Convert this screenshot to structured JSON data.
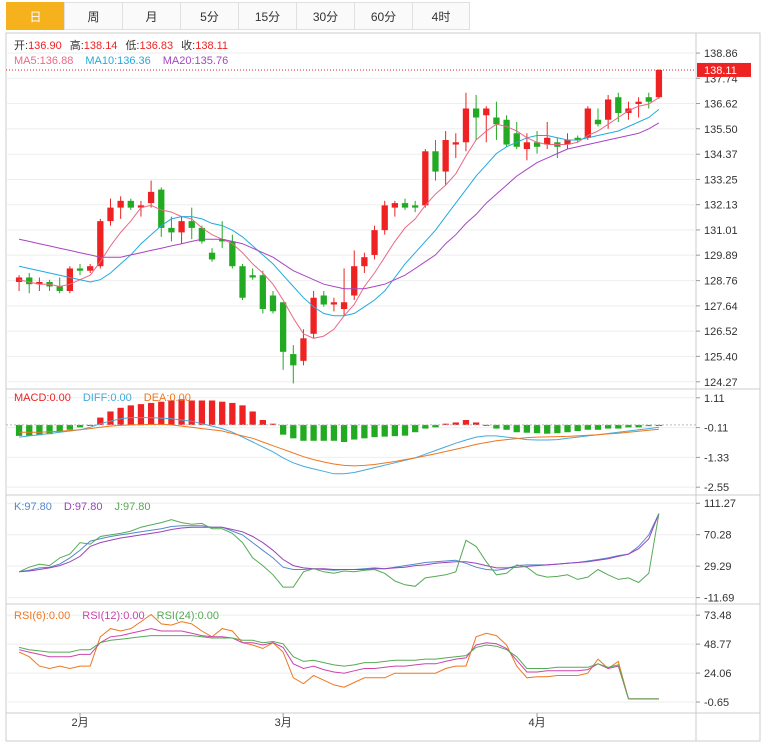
{
  "tabs": [
    {
      "label": "日",
      "active": true
    },
    {
      "label": "周",
      "active": false
    },
    {
      "label": "月",
      "active": false
    },
    {
      "label": "5分",
      "active": false
    },
    {
      "label": "15分",
      "active": false
    },
    {
      "label": "30分",
      "active": false
    },
    {
      "label": "60分",
      "active": false
    },
    {
      "label": "4时",
      "active": false
    }
  ],
  "colors": {
    "up": "#ee2222",
    "down": "#22aa22",
    "ma5": "#e86a86",
    "ma10": "#22aadd",
    "ma20": "#a844c4",
    "diff": "#44aadd",
    "dea": "#ee7722",
    "k": "#5588cc",
    "d": "#9944bb",
    "j": "#55aa55",
    "rsi6": "#ee7722",
    "rsi12": "#cc44aa",
    "rsi24": "#55aa55"
  },
  "chart_data": [
    {
      "type": "candlestick",
      "legend_ohlc": [
        {
          "label": "开:",
          "value": "136.90"
        },
        {
          "label": "高:",
          "value": "138.14"
        },
        {
          "label": "低:",
          "value": "136.83"
        },
        {
          "label": "收:",
          "value": "138.11"
        }
      ],
      "legend_ma": [
        {
          "label": "MA5:",
          "value": "136.88",
          "color_key": "ma5"
        },
        {
          "label": "MA10:",
          "value": "136.36",
          "color_key": "ma10"
        },
        {
          "label": "MA20:",
          "value": "135.76",
          "color_key": "ma20"
        }
      ],
      "y_ticks": [
        "138.86",
        "137.74",
        "136.62",
        "135.50",
        "134.37",
        "133.25",
        "132.13",
        "131.01",
        "129.89",
        "128.76",
        "127.64",
        "126.52",
        "125.40",
        "124.27"
      ],
      "ylim": [
        123.95,
        139.75
      ],
      "last_price": "138.11",
      "ohlc": [
        [
          128.7,
          129.0,
          128.3,
          128.9
        ],
        [
          128.9,
          129.1,
          128.2,
          128.6
        ],
        [
          128.6,
          128.9,
          128.3,
          128.7
        ],
        [
          128.7,
          128.8,
          128.3,
          128.5
        ],
        [
          128.5,
          128.9,
          128.2,
          128.3
        ],
        [
          128.3,
          129.4,
          128.2,
          129.3
        ],
        [
          129.3,
          129.5,
          129.0,
          129.2
        ],
        [
          129.2,
          129.5,
          129.1,
          129.4
        ],
        [
          129.4,
          131.5,
          129.3,
          131.4
        ],
        [
          131.4,
          132.4,
          131.2,
          132.0
        ],
        [
          132.0,
          132.5,
          131.5,
          132.3
        ],
        [
          132.3,
          132.4,
          131.9,
          132.0
        ],
        [
          132.0,
          132.3,
          131.6,
          132.1
        ],
        [
          132.2,
          133.2,
          132.0,
          132.7
        ],
        [
          132.8,
          132.9,
          130.7,
          131.1
        ],
        [
          131.1,
          131.6,
          130.5,
          130.9
        ],
        [
          130.9,
          131.6,
          130.4,
          131.4
        ],
        [
          131.4,
          132.0,
          130.6,
          131.1
        ],
        [
          131.1,
          131.2,
          130.4,
          130.5
        ],
        [
          130.0,
          130.2,
          129.6,
          129.7
        ],
        [
          130.6,
          131.4,
          130.2,
          130.5
        ],
        [
          130.5,
          130.8,
          129.3,
          129.4
        ],
        [
          129.4,
          129.5,
          127.9,
          128.0
        ],
        [
          129.0,
          129.3,
          128.8,
          128.9
        ],
        [
          129.0,
          129.2,
          127.3,
          127.5
        ],
        [
          128.1,
          128.3,
          127.3,
          127.4
        ],
        [
          127.8,
          127.8,
          124.8,
          125.6
        ],
        [
          125.5,
          125.9,
          124.2,
          125.0
        ],
        [
          125.2,
          126.6,
          125.0,
          126.2
        ],
        [
          126.4,
          128.3,
          126.2,
          128.0
        ],
        [
          128.1,
          128.3,
          127.6,
          127.7
        ],
        [
          127.7,
          128.0,
          127.4,
          127.8
        ],
        [
          127.5,
          129.3,
          127.2,
          127.8
        ],
        [
          128.1,
          130.1,
          127.9,
          129.4
        ],
        [
          129.4,
          130.0,
          129.1,
          129.8
        ],
        [
          129.9,
          131.2,
          129.7,
          131.0
        ],
        [
          131.0,
          132.3,
          130.8,
          132.1
        ],
        [
          132.0,
          132.3,
          131.6,
          132.2
        ],
        [
          132.2,
          132.4,
          131.9,
          132.0
        ],
        [
          132.1,
          132.3,
          131.8,
          132.0
        ],
        [
          132.1,
          134.6,
          132.0,
          134.5
        ],
        [
          134.5,
          135.0,
          133.2,
          133.6
        ],
        [
          133.6,
          135.4,
          133.0,
          135.0
        ],
        [
          134.8,
          135.3,
          134.2,
          134.9
        ],
        [
          134.9,
          137.1,
          134.5,
          136.4
        ],
        [
          136.4,
          137.0,
          135.0,
          136.0
        ],
        [
          136.1,
          136.5,
          134.9,
          136.4
        ],
        [
          136.0,
          136.7,
          135.0,
          135.7
        ],
        [
          135.9,
          136.1,
          134.7,
          134.8
        ],
        [
          135.3,
          135.8,
          134.6,
          134.7
        ],
        [
          134.6,
          135.3,
          134.1,
          134.9
        ],
        [
          134.9,
          135.4,
          134.4,
          134.7
        ],
        [
          134.8,
          135.8,
          134.6,
          135.1
        ],
        [
          134.9,
          135.1,
          134.2,
          134.7
        ],
        [
          134.8,
          135.3,
          134.6,
          135.0
        ],
        [
          135.1,
          135.2,
          134.9,
          135.0
        ],
        [
          135.1,
          136.5,
          135.0,
          136.4
        ],
        [
          135.9,
          136.4,
          135.6,
          135.7
        ],
        [
          135.9,
          137.0,
          135.5,
          136.8
        ],
        [
          136.9,
          137.1,
          135.8,
          136.2
        ],
        [
          136.2,
          136.7,
          135.9,
          136.4
        ],
        [
          136.6,
          136.9,
          136.0,
          136.7
        ],
        [
          136.9,
          137.1,
          136.4,
          136.7
        ],
        [
          136.9,
          138.14,
          136.83,
          138.11
        ]
      ],
      "ma5": [
        128.8,
        128.7,
        128.6,
        128.6,
        128.5,
        128.6,
        128.8,
        129.0,
        129.6,
        130.3,
        130.9,
        131.4,
        132.0,
        132.1,
        131.9,
        131.8,
        131.6,
        131.5,
        131.1,
        130.8,
        130.6,
        130.4,
        130.0,
        129.5,
        129.1,
        128.6,
        127.9,
        127.1,
        126.4,
        126.2,
        126.3,
        126.6,
        127.2,
        127.7,
        128.5,
        129.1,
        129.8,
        130.5,
        131.1,
        131.5,
        132.1,
        132.6,
        133.0,
        133.5,
        134.3,
        135.0,
        135.4,
        135.7,
        135.6,
        135.4,
        135.1,
        134.9,
        134.8,
        134.8,
        134.8,
        134.9,
        135.2,
        135.4,
        135.7,
        136.0,
        136.3,
        136.5,
        136.6,
        136.88
      ],
      "ma10": [
        129.4,
        129.3,
        129.2,
        129.1,
        129.0,
        128.9,
        128.8,
        128.7,
        128.8,
        129.1,
        129.5,
        129.9,
        130.4,
        130.8,
        131.2,
        131.5,
        131.6,
        131.6,
        131.5,
        131.3,
        131.2,
        131.0,
        130.7,
        130.3,
        129.9,
        129.5,
        129.0,
        128.5,
        128.0,
        127.6,
        127.3,
        127.2,
        127.2,
        127.3,
        127.6,
        127.9,
        128.3,
        128.9,
        129.5,
        130.0,
        130.5,
        131.0,
        131.6,
        132.2,
        132.8,
        133.4,
        133.9,
        134.4,
        134.7,
        134.9,
        135.1,
        135.2,
        135.2,
        135.1,
        135.0,
        135.0,
        135.1,
        135.2,
        135.3,
        135.4,
        135.6,
        135.8,
        136.0,
        136.36
      ],
      "ma20": [
        130.6,
        130.5,
        130.4,
        130.3,
        130.2,
        130.1,
        130.0,
        129.9,
        129.8,
        129.8,
        129.8,
        129.9,
        130.0,
        130.1,
        130.2,
        130.3,
        130.4,
        130.5,
        130.6,
        130.6,
        130.6,
        130.5,
        130.4,
        130.2,
        130.0,
        129.8,
        129.5,
        129.2,
        129.0,
        128.8,
        128.6,
        128.5,
        128.4,
        128.4,
        128.4,
        128.5,
        128.6,
        128.8,
        129.0,
        129.3,
        129.6,
        129.9,
        130.4,
        130.8,
        131.3,
        131.7,
        132.2,
        132.6,
        133.0,
        133.4,
        133.7,
        134.0,
        134.2,
        134.4,
        134.6,
        134.7,
        134.8,
        134.9,
        135.0,
        135.1,
        135.2,
        135.3,
        135.5,
        135.76
      ]
    },
    {
      "type": "bar",
      "legend": [
        {
          "label": "MACD:",
          "value": "0.00",
          "color_key": "up"
        },
        {
          "label": "DIFF:",
          "value": "0.00",
          "color_key": "diff"
        },
        {
          "label": "DEA:",
          "value": "0.00",
          "color_key": "dea"
        }
      ],
      "y_ticks": [
        "1.11",
        "-0.11",
        "-1.33",
        "-2.55"
      ],
      "ylim": [
        -2.87,
        1.47
      ],
      "macd": [
        -0.45,
        -0.45,
        -0.42,
        -0.38,
        -0.3,
        -0.2,
        -0.1,
        0,
        0.3,
        0.55,
        0.7,
        0.8,
        0.85,
        0.9,
        0.95,
        1.0,
        1.05,
        1.0,
        1.0,
        1.0,
        0.95,
        0.9,
        0.8,
        0.55,
        0.2,
        0.05,
        -0.4,
        -0.55,
        -0.65,
        -0.65,
        -0.65,
        -0.65,
        -0.7,
        -0.6,
        -0.55,
        -0.5,
        -0.48,
        -0.46,
        -0.44,
        -0.3,
        -0.15,
        -0.1,
        0.05,
        0.1,
        0.2,
        0.1,
        0,
        -0.15,
        -0.2,
        -0.3,
        -0.32,
        -0.34,
        -0.36,
        -0.34,
        -0.3,
        -0.25,
        -0.2,
        -0.2,
        -0.15,
        -0.15,
        -0.1,
        -0.1,
        -0.05,
        0
      ],
      "diff": [
        -0.5,
        -0.45,
        -0.4,
        -0.35,
        -0.3,
        -0.25,
        -0.2,
        -0.1,
        0.05,
        0.15,
        0.25,
        0.3,
        0.3,
        0.3,
        0.28,
        0.25,
        0.2,
        0.15,
        0.05,
        -0.05,
        -0.15,
        -0.3,
        -0.5,
        -0.7,
        -0.9,
        -1.1,
        -1.35,
        -1.55,
        -1.7,
        -1.8,
        -1.9,
        -2.0,
        -2.0,
        -1.95,
        -1.85,
        -1.75,
        -1.65,
        -1.55,
        -1.45,
        -1.35,
        -1.2,
        -1.05,
        -0.9,
        -0.75,
        -0.62,
        -0.5,
        -0.45,
        -0.45,
        -0.5,
        -0.55,
        -0.6,
        -0.62,
        -0.62,
        -0.6,
        -0.55,
        -0.5,
        -0.45,
        -0.4,
        -0.35,
        -0.3,
        -0.25,
        -0.2,
        -0.15,
        -0.1
      ],
      "dea": [
        -0.3,
        -0.3,
        -0.3,
        -0.28,
        -0.26,
        -0.23,
        -0.2,
        -0.15,
        -0.1,
        -0.05,
        -0.02,
        0.0,
        0.01,
        0.02,
        0.02,
        0.0,
        -0.05,
        -0.1,
        -0.15,
        -0.2,
        -0.25,
        -0.35,
        -0.45,
        -0.55,
        -0.7,
        -0.85,
        -1.0,
        -1.15,
        -1.3,
        -1.42,
        -1.52,
        -1.6,
        -1.66,
        -1.68,
        -1.66,
        -1.62,
        -1.56,
        -1.5,
        -1.42,
        -1.35,
        -1.27,
        -1.18,
        -1.09,
        -1.0,
        -0.9,
        -0.8,
        -0.72,
        -0.65,
        -0.6,
        -0.56,
        -0.52,
        -0.5,
        -0.49,
        -0.48,
        -0.47,
        -0.45,
        -0.42,
        -0.4,
        -0.37,
        -0.34,
        -0.3,
        -0.26,
        -0.22,
        -0.18
      ]
    },
    {
      "type": "line",
      "legend": [
        {
          "label": "K:",
          "value": "97.80",
          "color_key": "k"
        },
        {
          "label": "D:",
          "value": "97.80",
          "color_key": "d"
        },
        {
          "label": "J:",
          "value": "97.80",
          "color_key": "j"
        }
      ],
      "y_ticks": [
        "111.27",
        "70.28",
        "29.29",
        "-11.69"
      ],
      "ylim": [
        -20.0,
        122.0
      ],
      "k": [
        22,
        24,
        27,
        28,
        32,
        40,
        50,
        62,
        65,
        68,
        70,
        72,
        74,
        76,
        78,
        81,
        82,
        82,
        82,
        80,
        80,
        75,
        70,
        60,
        50,
        40,
        28,
        25,
        25,
        26,
        25,
        24,
        25,
        25,
        26,
        27,
        26,
        28,
        30,
        32,
        34,
        35,
        36,
        37,
        33,
        28,
        25,
        24,
        26,
        30,
        31,
        31,
        31,
        32,
        33,
        34,
        36,
        38,
        40,
        43,
        45,
        55,
        70,
        97.8
      ],
      "d": [
        22,
        23,
        25,
        27,
        30,
        35,
        42,
        55,
        60,
        63,
        66,
        68,
        70,
        72,
        74,
        77,
        79,
        80,
        80,
        80,
        80,
        77,
        74,
        68,
        60,
        50,
        38,
        30,
        27,
        26,
        26,
        25,
        25,
        25,
        25,
        26,
        26,
        27,
        28,
        30,
        31,
        33,
        34,
        35,
        35,
        33,
        30,
        27,
        27,
        28,
        29,
        30,
        31,
        32,
        33,
        34,
        35,
        37,
        39,
        42,
        45,
        52,
        65,
        97.8
      ],
      "j": [
        22,
        28,
        32,
        30,
        40,
        45,
        60,
        58,
        68,
        70,
        72,
        75,
        80,
        83,
        86,
        90,
        86,
        84,
        85,
        78,
        78,
        72,
        60,
        40,
        30,
        18,
        2,
        2,
        22,
        26,
        22,
        20,
        23,
        22,
        24,
        25,
        20,
        10,
        5,
        3,
        14,
        16,
        18,
        22,
        63,
        55,
        35,
        18,
        20,
        31,
        28,
        18,
        15,
        16,
        18,
        12,
        15,
        25,
        18,
        12,
        14,
        8,
        20,
        97.8
      ]
    },
    {
      "type": "line",
      "legend": [
        {
          "label": "RSI(6):",
          "value": "0.00",
          "color_key": "rsi6"
        },
        {
          "label": "RSI(12):",
          "value": "0.00",
          "color_key": "rsi12"
        },
        {
          "label": "RSI(24):",
          "value": "0.00",
          "color_key": "rsi24"
        }
      ],
      "y_ticks": [
        "73.48",
        "48.77",
        "24.06",
        "-0.65"
      ],
      "ylim": [
        -10.0,
        83.0
      ],
      "x_labels": [
        {
          "label": "2月",
          "index": 6
        },
        {
          "label": "3月",
          "index": 26
        },
        {
          "label": "4月",
          "index": 51
        }
      ],
      "rsi6": [
        42,
        38,
        30,
        28,
        30,
        28,
        30,
        30,
        55,
        62,
        60,
        62,
        68,
        74,
        66,
        65,
        68,
        66,
        60,
        55,
        62,
        60,
        50,
        48,
        45,
        50,
        42,
        20,
        15,
        22,
        18,
        14,
        12,
        16,
        20,
        20,
        20,
        24,
        24,
        24,
        24,
        24,
        28,
        30,
        30,
        55,
        58,
        56,
        48,
        30,
        20,
        21,
        21,
        22,
        22,
        22,
        24,
        36,
        28,
        34,
        2,
        2,
        2,
        2
      ],
      "rsi12": [
        44,
        42,
        40,
        38,
        38,
        38,
        40,
        40,
        50,
        55,
        56,
        58,
        60,
        62,
        60,
        60,
        60,
        58,
        56,
        55,
        55,
        54,
        50,
        50,
        48,
        50,
        46,
        32,
        28,
        30,
        27,
        25,
        24,
        26,
        28,
        28,
        29,
        30,
        30,
        31,
        32,
        32,
        34,
        36,
        37,
        48,
        50,
        49,
        45,
        35,
        25,
        25,
        26,
        26,
        26,
        26,
        27,
        32,
        28,
        30,
        2,
        2,
        2,
        2
      ],
      "rsi24": [
        46,
        44,
        43,
        42,
        42,
        42,
        44,
        44,
        50,
        52,
        53,
        54,
        55,
        56,
        56,
        56,
        56,
        56,
        55,
        54,
        54,
        54,
        52,
        52,
        50,
        51,
        49,
        38,
        34,
        35,
        33,
        31,
        30,
        31,
        33,
        33,
        34,
        35,
        35,
        35,
        36,
        36,
        37,
        38,
        39,
        46,
        48,
        47,
        44,
        38,
        28,
        28,
        28,
        29,
        29,
        29,
        29,
        32,
        29,
        31,
        2,
        2,
        2,
        2
      ]
    }
  ]
}
